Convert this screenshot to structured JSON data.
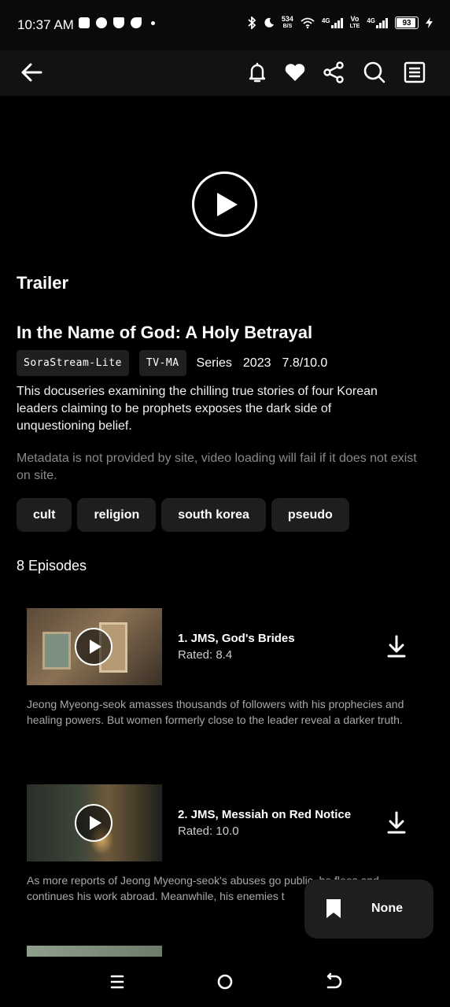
{
  "status_bar": {
    "time": "10:37 AM",
    "net_speed_value": "534",
    "net_speed_unit": "B/S",
    "sim1_label": "4G",
    "volte_top": "Vo",
    "volte_bottom": "LTE",
    "sim2_label": "4G",
    "battery": "93"
  },
  "app_bar": {
    "icons": [
      "back-arrow",
      "bell",
      "heart",
      "share",
      "search",
      "list"
    ]
  },
  "player": {
    "section_label": "Trailer"
  },
  "show": {
    "title": "In the Name of God: A Holy Betrayal",
    "source": "SoraStream-Lite",
    "rating_badge": "TV-MA",
    "type": "Series",
    "year": "2023",
    "score": "7.8/10.0",
    "description": "This docuseries examining the chilling true stories of four Korean leaders claiming to be prophets exposes the dark side of unquestioning belief.",
    "note": "Metadata is not provided by site, video loading will fail if it does not exist on site.",
    "tags": [
      "cult",
      "religion",
      "south korea",
      "pseudo"
    ],
    "episode_count": "8 Episodes"
  },
  "episodes": [
    {
      "title": "1. JMS, God's Brides",
      "rating": "Rated: 8.4",
      "description": "Jeong Myeong-seok amasses thousands of followers with his prophecies and healing powers. But women formerly close to the leader reveal a darker truth."
    },
    {
      "title": "2. JMS, Messiah on Red Notice",
      "rating": "Rated: 10.0",
      "description": "As more reports of Jeong Myeong-seok's abuses go public, he flees and continues his work abroad. Meanwhile, his enemies t"
    }
  ],
  "bookmark": {
    "label": "None"
  },
  "colors": {
    "background": "#000000",
    "app_bar": "#121212",
    "chip": "#1f1f1f",
    "muted_text": "#8a8a8a"
  }
}
